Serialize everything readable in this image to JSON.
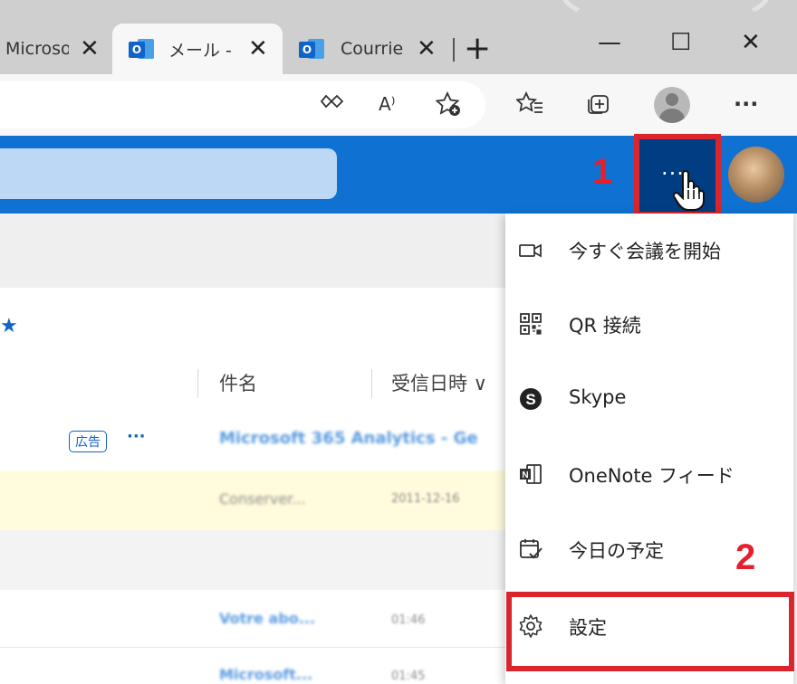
{
  "browser": {
    "tabs": [
      {
        "label": "Microsoft",
        "close": "✕"
      },
      {
        "label": "メール - Outlook",
        "close": "✕",
        "active": true
      },
      {
        "label": "Courrier",
        "close": "✕"
      }
    ],
    "new_tab": "+",
    "window_controls": {
      "minimize": "—",
      "maximize": "☐",
      "close": "✕"
    },
    "toolbar_icons": [
      "reader-mode-icon",
      "read-aloud-icon",
      "add-favorite-icon",
      "favorites-icon",
      "collections-icon",
      "profile-icon",
      "more-icon"
    ],
    "read_aloud_glyph": "A⁾",
    "more_glyph": "···"
  },
  "outlook": {
    "header": {
      "more_glyph": "···",
      "brand_color": "#0f72d2"
    },
    "columns": {
      "subject": "件名",
      "date": "受信日時 ∨"
    },
    "star_glyph": "★",
    "ad": {
      "badge": "広告",
      "more": "···",
      "subject": "Microsoft 365 Analytics - Ge"
    },
    "rows": [
      {
        "subject": "Conserver...",
        "date": "2011-12-16"
      },
      {
        "subject": "Votre abo...",
        "date": "01:46"
      },
      {
        "subject": "Microsoft...",
        "date": "01:45"
      }
    ]
  },
  "menu": {
    "items": [
      {
        "label": "今すぐ会議を開始",
        "icon": "video-camera-icon"
      },
      {
        "label": "QR 接続",
        "icon": "qr-code-icon"
      },
      {
        "label": "Skype",
        "icon": "skype-icon"
      },
      {
        "label": "OneNote フィード",
        "icon": "onenote-icon"
      },
      {
        "label": "今日の予定",
        "icon": "calendar-check-icon"
      },
      {
        "label": "設定",
        "icon": "gear-icon"
      }
    ]
  },
  "annotations": {
    "step1": "1",
    "step2": "2",
    "highlight_color": "#d9252d"
  }
}
